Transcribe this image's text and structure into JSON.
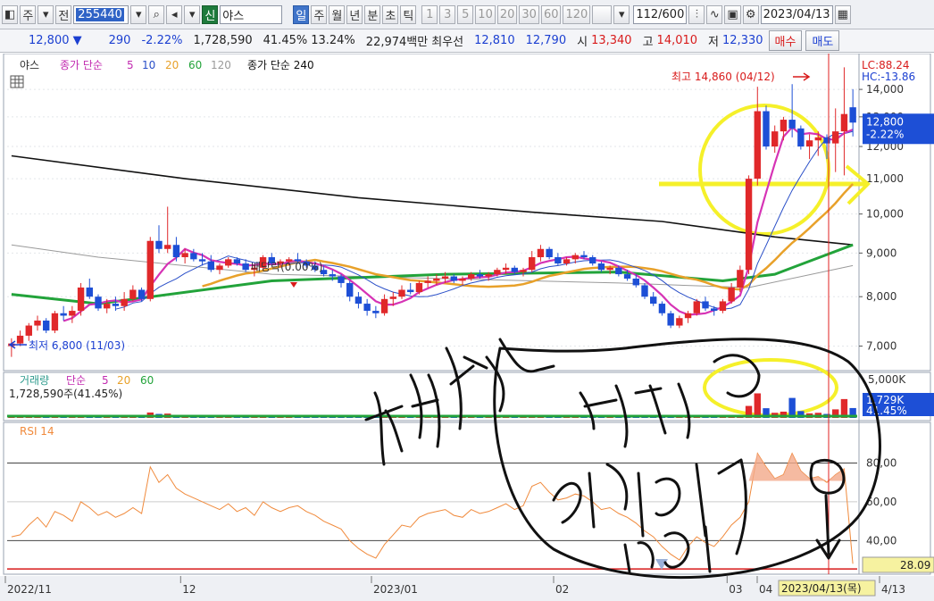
{
  "toolbar": {
    "type_label": "주",
    "view_label": "전",
    "stock_code": "255440",
    "credit_tag": "신",
    "stock_name": "야스",
    "period_tabs": [
      "일",
      "주",
      "월",
      "년",
      "분",
      "초",
      "틱"
    ],
    "interval_tabs": [
      "1",
      "3",
      "5",
      "10",
      "20",
      "30",
      "60",
      "120"
    ],
    "count": "112",
    "count_total": "/600",
    "date": "2023/04/13"
  },
  "quote": {
    "price": "12,800",
    "change": "290",
    "change_pct": "-2.22%",
    "volume": "1,728,590",
    "volume_pct": "41.45%",
    "turnover_pct": "13.24%",
    "amount": "22,974백만",
    "best_label": "최우선",
    "best_ask": "12,810",
    "best_bid": "12,790",
    "open_label": "시",
    "open": "13,340",
    "high_label": "고",
    "high": "14,010",
    "low_label": "저",
    "low": "12,330",
    "buy_label": "매수",
    "sell_label": "매도"
  },
  "colors": {
    "up": "#e0282a",
    "down": "#1d4fd6",
    "ma5": "#d633b5",
    "ma10": "#2a4fc8",
    "ma20": "#e8a12a",
    "ma60": "#22a33a",
    "ma120": "#9a9a9a",
    "ma240": "#111111",
    "rsi": "#f08a3c",
    "highlight": "#f5f02a"
  },
  "price_panel": {
    "legend_name": "야스",
    "legend_ma_label": "종가 단순",
    "legend_periods": [
      "5",
      "10",
      "20",
      "60",
      "120"
    ],
    "legend_ma240": "종가 단순 240",
    "lc": "LC:88.24",
    "hc": "HC:-13.86",
    "current_price": "12,800",
    "current_change": "-2.22%",
    "high_note": "최고 14,860 (04/12)",
    "low_note": "최저 6,800 (11/03)",
    "dividend_note": "배당락(0.00%)"
  },
  "volume_panel": {
    "legend_name": "거래량",
    "legend_ma": "단순",
    "legend_periods": [
      "5",
      "20",
      "60"
    ],
    "info": "1,728,590주(41.45%)",
    "axis_label": "5,000K",
    "current": "1,729K",
    "current_pct": "41.45%"
  },
  "rsi_panel": {
    "legend": "RSI 14",
    "current": "28.09"
  },
  "x_axis": {
    "labels": [
      "2022/11",
      "12",
      "2023/01",
      "02",
      "03",
      "04",
      "4/13"
    ],
    "cursor_date": "2023/04/13(목)"
  },
  "chart_data": [
    {
      "type": "candlestick",
      "yscale": "log",
      "ylim": [
        6600,
        15200
      ],
      "y_ticks": [
        "14,000",
        "13,000",
        "12,000",
        "11,000",
        "10,000",
        "9,000",
        "8,000",
        "7,000"
      ],
      "tick_values": [
        14000,
        13000,
        12000,
        11000,
        10000,
        9000,
        8000,
        7000
      ],
      "candles": [
        [
          7000,
          7150,
          6800,
          7050
        ],
        [
          7050,
          7300,
          7000,
          7200
        ],
        [
          7200,
          7450,
          7100,
          7400
        ],
        [
          7400,
          7600,
          7300,
          7500
        ],
        [
          7500,
          7550,
          7250,
          7300
        ],
        [
          7300,
          7700,
          7250,
          7650
        ],
        [
          7650,
          7800,
          7500,
          7600
        ],
        [
          7600,
          7800,
          7450,
          7700
        ],
        [
          7700,
          8300,
          7600,
          8200
        ],
        [
          8200,
          8400,
          7950,
          8000
        ],
        [
          8000,
          8050,
          7700,
          7750
        ],
        [
          7750,
          7950,
          7650,
          7850
        ],
        [
          7850,
          8000,
          7700,
          7800
        ],
        [
          7800,
          8100,
          7700,
          7950
        ],
        [
          7950,
          8250,
          7900,
          8150
        ],
        [
          8150,
          8200,
          7900,
          7950
        ],
        [
          7950,
          9400,
          7900,
          9300
        ],
        [
          9300,
          9700,
          9000,
          9100
        ],
        [
          9100,
          10200,
          9000,
          9200
        ],
        [
          9200,
          9400,
          8800,
          8900
        ],
        [
          8900,
          9100,
          8750,
          9000
        ],
        [
          9000,
          9100,
          8800,
          8850
        ],
        [
          8850,
          9000,
          8700,
          8800
        ],
        [
          8800,
          8950,
          8550,
          8600
        ],
        [
          8600,
          8750,
          8500,
          8700
        ],
        [
          8700,
          8900,
          8650,
          8850
        ],
        [
          8850,
          8900,
          8700,
          8750
        ],
        [
          8750,
          8850,
          8550,
          8600
        ],
        [
          8600,
          8700,
          8450,
          8650
        ],
        [
          8650,
          8950,
          8600,
          8900
        ],
        [
          8900,
          9000,
          8700,
          8750
        ],
        [
          8750,
          8850,
          8650,
          8800
        ],
        [
          8800,
          8900,
          8700,
          8850
        ],
        [
          8850,
          9000,
          8750,
          8800
        ],
        [
          8800,
          8850,
          8650,
          8700
        ],
        [
          8700,
          8800,
          8550,
          8600
        ],
        [
          8600,
          8700,
          8450,
          8500
        ],
        [
          8500,
          8600,
          8350,
          8450
        ],
        [
          8450,
          8500,
          8200,
          8300
        ],
        [
          8300,
          8350,
          7900,
          8000
        ],
        [
          8000,
          8100,
          7750,
          7850
        ],
        [
          7850,
          7950,
          7600,
          7700
        ],
        [
          7700,
          7800,
          7550,
          7650
        ],
        [
          7650,
          8050,
          7600,
          7950
        ],
        [
          7950,
          8100,
          7800,
          8000
        ],
        [
          8000,
          8250,
          7950,
          8150
        ],
        [
          8150,
          8300,
          8050,
          8100
        ],
        [
          8100,
          8350,
          8050,
          8300
        ],
        [
          8300,
          8450,
          8200,
          8350
        ],
        [
          8350,
          8500,
          8250,
          8400
        ],
        [
          8400,
          8550,
          8300,
          8450
        ],
        [
          8450,
          8500,
          8300,
          8350
        ],
        [
          8350,
          8450,
          8250,
          8400
        ],
        [
          8400,
          8550,
          8350,
          8500
        ],
        [
          8500,
          8600,
          8400,
          8450
        ],
        [
          8450,
          8550,
          8350,
          8500
        ],
        [
          8500,
          8650,
          8450,
          8600
        ],
        [
          8600,
          8750,
          8500,
          8650
        ],
        [
          8650,
          8700,
          8500,
          8550
        ],
        [
          8550,
          8650,
          8450,
          8600
        ],
        [
          8600,
          9050,
          8550,
          8900
        ],
        [
          8900,
          9200,
          8800,
          9100
        ],
        [
          9100,
          9150,
          8850,
          8900
        ],
        [
          8900,
          9000,
          8700,
          8750
        ],
        [
          8750,
          8900,
          8700,
          8850
        ],
        [
          8850,
          9000,
          8750,
          8950
        ],
        [
          8950,
          9050,
          8850,
          8900
        ],
        [
          8900,
          8950,
          8700,
          8750
        ],
        [
          8750,
          8800,
          8550,
          8600
        ],
        [
          8600,
          8700,
          8500,
          8650
        ],
        [
          8650,
          8700,
          8450,
          8500
        ],
        [
          8500,
          8600,
          8350,
          8400
        ],
        [
          8400,
          8500,
          8200,
          8250
        ],
        [
          8250,
          8300,
          7950,
          8000
        ],
        [
          8000,
          8100,
          7800,
          7850
        ],
        [
          7850,
          7900,
          7600,
          7650
        ],
        [
          7650,
          7700,
          7350,
          7400
        ],
        [
          7400,
          7600,
          7350,
          7550
        ],
        [
          7550,
          7700,
          7450,
          7650
        ],
        [
          7650,
          7950,
          7600,
          7900
        ],
        [
          7900,
          8000,
          7700,
          7750
        ],
        [
          7750,
          7800,
          7600,
          7700
        ],
        [
          7700,
          7950,
          7650,
          7900
        ],
        [
          7900,
          8300,
          7850,
          8200
        ],
        [
          8200,
          8700,
          8100,
          8600
        ],
        [
          8600,
          11100,
          8500,
          11000
        ],
        [
          11000,
          14100,
          10800,
          13200
        ],
        [
          13200,
          13400,
          11900,
          12000
        ],
        [
          12000,
          12700,
          11800,
          12500
        ],
        [
          12500,
          13000,
          12200,
          12900
        ],
        [
          12900,
          14200,
          12300,
          12600
        ],
        [
          12600,
          12700,
          11900,
          12000
        ],
        [
          12000,
          12400,
          11600,
          12200
        ],
        [
          12200,
          12500,
          11700,
          12300
        ],
        [
          12300,
          12400,
          11600,
          12100
        ],
        [
          12100,
          13300,
          11200,
          12500
        ],
        [
          12500,
          14860,
          11100,
          13100
        ],
        [
          13340,
          14010,
          12330,
          12800
        ]
      ],
      "ma5_from": 6,
      "ma10_from": 12,
      "ma20_from": 22,
      "ma60": [
        [
          0,
          8050
        ],
        [
          10,
          7850
        ],
        [
          30,
          8350
        ],
        [
          50,
          8500
        ],
        [
          70,
          8550
        ],
        [
          82,
          8350
        ],
        [
          88,
          8500
        ],
        [
          97,
          9200
        ]
      ],
      "ma120": [
        [
          0,
          9200
        ],
        [
          10,
          8900
        ],
        [
          30,
          8500
        ],
        [
          50,
          8400
        ],
        [
          70,
          8300
        ],
        [
          85,
          8200
        ],
        [
          97,
          8700
        ]
      ],
      "ma240": [
        [
          0,
          11700
        ],
        [
          20,
          11000
        ],
        [
          40,
          10450
        ],
        [
          60,
          10050
        ],
        [
          75,
          9800
        ],
        [
          88,
          9400
        ],
        [
          97,
          9200
        ]
      ]
    },
    {
      "type": "bar",
      "name": "volume",
      "ylim": [
        0,
        5000
      ],
      "values": [
        120,
        140,
        110,
        160,
        100,
        130,
        120,
        110,
        180,
        140,
        100,
        110,
        100,
        120,
        130,
        110,
        950,
        700,
        760,
        300,
        180,
        160,
        150,
        140,
        130,
        150,
        120,
        130,
        110,
        170,
        140,
        120,
        120,
        110,
        100,
        110,
        100,
        110,
        120,
        160,
        140,
        130,
        110,
        150,
        130,
        140,
        120,
        140,
        150,
        130,
        140,
        120,
        110,
        150,
        120,
        130,
        140,
        160,
        130,
        120,
        200,
        180,
        150,
        140,
        130,
        150,
        130,
        140,
        130,
        120,
        130,
        140,
        150,
        160,
        170,
        180,
        190,
        150,
        140,
        170,
        130,
        120,
        150,
        190,
        300,
        2100,
        4300,
        1700,
        900,
        1100,
        3500,
        1200,
        800,
        900,
        700,
        1500,
        3300,
        1729
      ]
    },
    {
      "type": "line",
      "name": "RSI 14",
      "ylim": [
        25,
        100
      ],
      "y_ticks": [
        "80,00",
        "60,00",
        "40,00"
      ],
      "tick_values": [
        80,
        60,
        40
      ],
      "values": [
        42,
        43,
        48,
        52,
        47,
        55,
        53,
        50,
        60,
        57,
        53,
        55,
        52,
        54,
        57,
        54,
        78,
        70,
        74,
        67,
        64,
        62,
        60,
        58,
        56,
        59,
        55,
        57,
        53,
        60,
        57,
        55,
        57,
        58,
        55,
        53,
        50,
        48,
        46,
        40,
        36,
        33,
        31,
        38,
        43,
        48,
        47,
        52,
        54,
        55,
        56,
        53,
        52,
        56,
        54,
        55,
        57,
        59,
        56,
        58,
        68,
        70,
        65,
        61,
        62,
        64,
        63,
        60,
        56,
        57,
        54,
        52,
        49,
        45,
        42,
        37,
        33,
        30,
        37,
        42,
        39,
        37,
        42,
        48,
        52,
        60,
        85,
        78,
        72,
        74,
        85,
        76,
        72,
        73,
        70,
        74,
        77,
        28.09
      ]
    }
  ]
}
